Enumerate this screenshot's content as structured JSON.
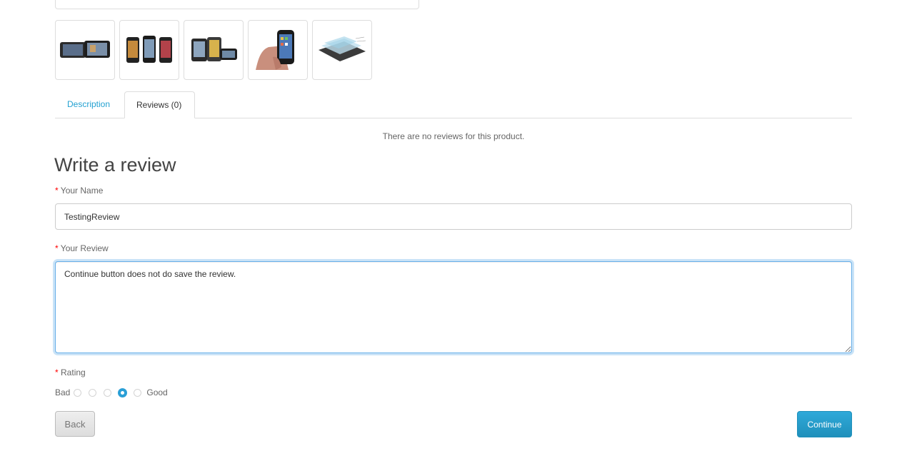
{
  "thumbnails": [
    {
      "icon": "phone-landscape-thumbnail"
    },
    {
      "icon": "phones-group-thumbnail"
    },
    {
      "icon": "phones-angle-thumbnail"
    },
    {
      "icon": "phone-in-hand-thumbnail"
    },
    {
      "icon": "phone-layers-thumbnail"
    }
  ],
  "tabs": {
    "description": "Description",
    "reviews": "Reviews (0)",
    "active": "reviews"
  },
  "reviews": {
    "empty_message": "There are no reviews for this product."
  },
  "form": {
    "title": "Write a review",
    "required_mark": "*",
    "name_label": "Your Name",
    "name_value": "TestingReview",
    "review_label": "Your Review",
    "review_value": "Continue button does not do save the review.",
    "rating_label": "Rating",
    "rating_low": "Bad",
    "rating_high": "Good",
    "rating_selected": 4,
    "rating_options": [
      1,
      2,
      3,
      4,
      5
    ]
  },
  "buttons": {
    "back": "Back",
    "continue": "Continue"
  },
  "colors": {
    "link": "#23a1d1",
    "primary": "#2a9fd6",
    "required": "#ff0000",
    "focus_border": "#66afe9"
  }
}
